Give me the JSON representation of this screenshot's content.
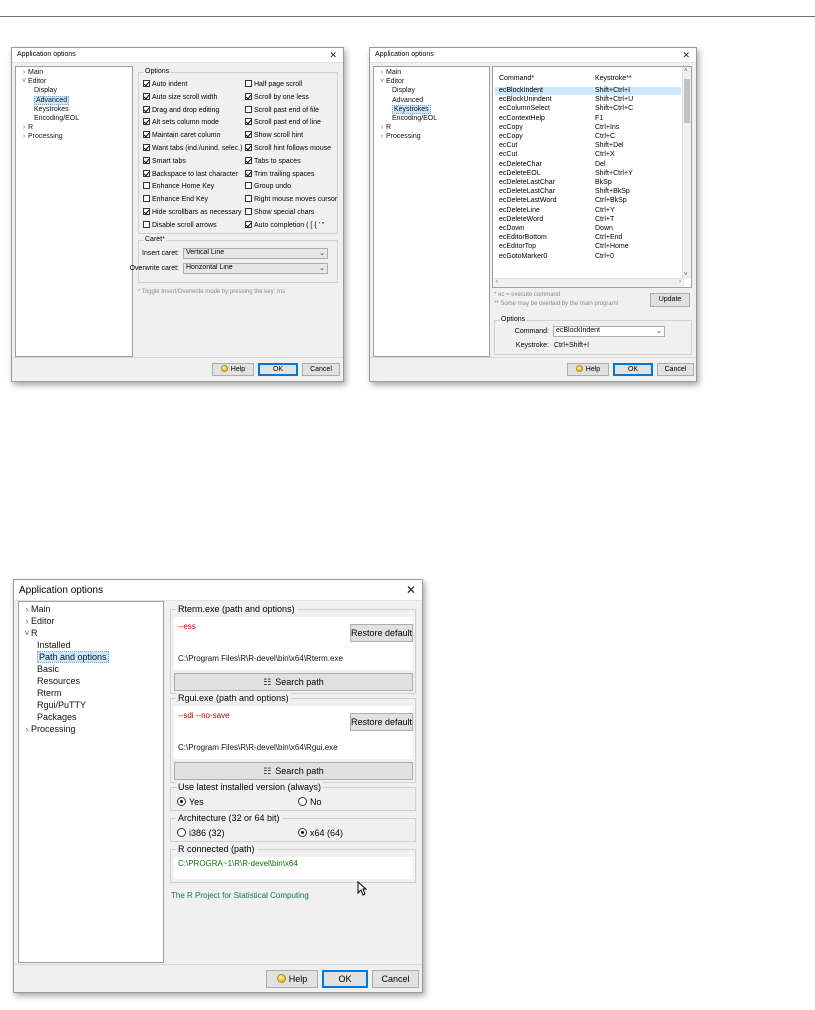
{
  "dialog_title": "Application options",
  "close_glyph": "✕",
  "tree_chev_closed": "›",
  "tree_chev_open": "˅",
  "buttons": {
    "help": "Help",
    "ok": "OK",
    "cancel": "Cancel",
    "update": "Update"
  },
  "win1": {
    "tree": [
      {
        "label": "Main",
        "level": 0,
        "chev": "closed"
      },
      {
        "label": "Editor",
        "level": 0,
        "chev": "open"
      },
      {
        "label": "Display",
        "level": 1
      },
      {
        "label": "Advanced",
        "level": 1,
        "selected": true
      },
      {
        "label": "Keystrokes",
        "level": 1
      },
      {
        "label": "Encoding/EOL",
        "level": 1
      },
      {
        "label": "R",
        "level": 0,
        "chev": "closed"
      },
      {
        "label": "Processing",
        "level": 0,
        "chev": "closed"
      }
    ],
    "options_caption": "Options",
    "options_left": [
      {
        "label": "Auto indent",
        "checked": true
      },
      {
        "label": "Auto size scroll width",
        "checked": true
      },
      {
        "label": "Drag and drop editing",
        "checked": true
      },
      {
        "label": "Alt sets column mode",
        "checked": true
      },
      {
        "label": "Maintain caret column",
        "checked": true
      },
      {
        "label": "Want tabs (ind./unind. selec.)",
        "checked": true
      },
      {
        "label": "Smart tabs",
        "checked": true
      },
      {
        "label": "Backspace to last character",
        "checked": true
      },
      {
        "label": "Enhance Home Key",
        "checked": false
      },
      {
        "label": "Enhance End Key",
        "checked": false
      },
      {
        "label": "Hide scrollbars as necessary",
        "checked": true
      },
      {
        "label": "Disable scroll arrows",
        "checked": false
      }
    ],
    "options_right": [
      {
        "label": "Half page scroll",
        "checked": false
      },
      {
        "label": "Scroll by one less",
        "checked": true
      },
      {
        "label": "Scroll past end of file",
        "checked": false
      },
      {
        "label": "Scroll past end of line",
        "checked": true
      },
      {
        "label": "Show scroll hint",
        "checked": true
      },
      {
        "label": "Scroll hint follows mouse",
        "checked": true
      },
      {
        "label": "Tabs to spaces",
        "checked": true
      },
      {
        "label": "Trim trailing spaces",
        "checked": true
      },
      {
        "label": "Group undo",
        "checked": false
      },
      {
        "label": "Right mouse moves cursor",
        "checked": false
      },
      {
        "label": "Show special chars",
        "checked": false
      },
      {
        "label": "Auto completion ( [ { ' \"",
        "checked": true
      }
    ],
    "caret_caption": "Caret*",
    "insert_caret_label": "Insert caret:",
    "insert_caret_value": "Vertical Line",
    "overwrite_caret_label": "Overwrite caret:",
    "overwrite_caret_value": "Horizontal Line",
    "toggle_note": "* Toggle Insert/Overwrite mode by pressing the key: Ins"
  },
  "win2": {
    "tree": [
      {
        "label": "Main",
        "level": 0,
        "chev": "closed"
      },
      {
        "label": "Editor",
        "level": 0,
        "chev": "open"
      },
      {
        "label": "Display",
        "level": 1
      },
      {
        "label": "Advanced",
        "level": 1
      },
      {
        "label": "Keystrokes",
        "level": 1,
        "selected": true
      },
      {
        "label": "Encoding/EOL",
        "level": 1
      },
      {
        "label": "R",
        "level": 0,
        "chev": "closed"
      },
      {
        "label": "Processing",
        "level": 0,
        "chev": "closed"
      }
    ],
    "col_command": "Command*",
    "col_keystroke": "Keystroke**",
    "rows": [
      {
        "cmd": "ecBlockIndent",
        "key": "Shift+Ctrl+I",
        "selected": true
      },
      {
        "cmd": "ecBlockUnindent",
        "key": "Shift+Ctrl+U"
      },
      {
        "cmd": "ecColumnSelect",
        "key": "Shift+Ctrl+C"
      },
      {
        "cmd": "ecContextHelp",
        "key": "F1"
      },
      {
        "cmd": "ecCopy",
        "key": "Ctrl+Ins"
      },
      {
        "cmd": "ecCopy",
        "key": "Ctrl+C"
      },
      {
        "cmd": "ecCut",
        "key": "Shift+Del"
      },
      {
        "cmd": "ecCut",
        "key": "Ctrl+X"
      },
      {
        "cmd": "ecDeleteChar",
        "key": "Del"
      },
      {
        "cmd": "ecDeleteEOL",
        "key": "Shift+Ctrl+Y"
      },
      {
        "cmd": "ecDeleteLastChar",
        "key": "BkSp"
      },
      {
        "cmd": "ecDeleteLastChar",
        "key": "Shift+BkSp"
      },
      {
        "cmd": "ecDeleteLastWord",
        "key": "Ctrl+BkSp"
      },
      {
        "cmd": "ecDeleteLine",
        "key": "Ctrl+Y"
      },
      {
        "cmd": "ecDeleteWord",
        "key": "Ctrl+T"
      },
      {
        "cmd": "ecDown",
        "key": "Down"
      },
      {
        "cmd": "ecEditorBottom",
        "key": "Ctrl+End"
      },
      {
        "cmd": "ecEditorTop",
        "key": "Ctrl+Home"
      },
      {
        "cmd": "ecGotoMarker0",
        "key": "Ctrl+0"
      }
    ],
    "note1": "* ec = execute command",
    "note2": "** Some may be overlaid by the main program!",
    "options_caption": "Options",
    "command_label": "Command:",
    "command_value": "ecBlockIndent",
    "keystroke_label": "Keystroke:",
    "keystroke_value": "Ctrl+Shift+I"
  },
  "win3": {
    "tree": [
      {
        "label": "Main",
        "level": 0,
        "chev": "closed"
      },
      {
        "label": "Editor",
        "level": 0,
        "chev": "closed"
      },
      {
        "label": "R",
        "level": 0,
        "chev": "open"
      },
      {
        "label": "Installed",
        "level": 1
      },
      {
        "label": "Path and options",
        "level": 1,
        "selected": true
      },
      {
        "label": "Basic",
        "level": 1
      },
      {
        "label": "Resources",
        "level": 1
      },
      {
        "label": "Rterm",
        "level": 1
      },
      {
        "label": "Rgui/PuTTY",
        "level": 1
      },
      {
        "label": "Packages",
        "level": 1
      },
      {
        "label": "Processing",
        "level": 0,
        "chev": "closed"
      }
    ],
    "rterm_caption": "Rterm.exe (path and options)",
    "rterm_options": "--ess",
    "rterm_path": "C:\\Program Files\\R\\R-devel\\bin\\x64\\Rterm.exe",
    "rgui_caption": "Rgui.exe (path and options)",
    "rgui_options": "--sdi --no-save",
    "rgui_path": "C:\\Program Files\\R\\R-devel\\bin\\x64\\Rgui.exe",
    "restore_default": "Restore default",
    "search_path": "Search path",
    "latest_caption": "Use latest installed version (always)",
    "yes": "Yes",
    "no": "No",
    "latest_value": "yes",
    "arch_caption": "Architecture (32 or 64 bit)",
    "i386": "i386 (32)",
    "x64": "x64 (64)",
    "arch_value": "x64",
    "connected_caption": "R connected (path)",
    "connected_path": "C:\\PROGRA~1\\R\\R-devel\\bin\\x64",
    "project_link": "The R Project for Statistical Computing"
  }
}
